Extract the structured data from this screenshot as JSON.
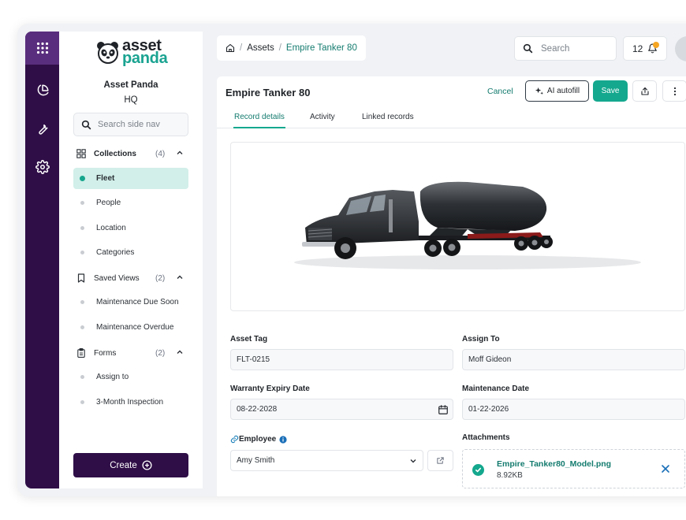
{
  "app": {
    "brand_asset": "asset",
    "brand_panda": "panda",
    "org_name": "Asset Panda",
    "org_sub": "HQ"
  },
  "sidenav": {
    "search_placeholder": "Search side nav",
    "groups": [
      {
        "label": "Collections",
        "count": "(4)",
        "items": [
          "Fleet",
          "People",
          "Location",
          "Categories"
        ],
        "active": "Fleet"
      },
      {
        "label": "Saved Views",
        "count": "(2)",
        "items": [
          "Maintenance Due Soon",
          "Maintenance Overdue"
        ]
      },
      {
        "label": "Forms",
        "count": "(2)",
        "items": [
          "Assign to",
          "3-Month Inspection"
        ]
      }
    ],
    "create_label": "Create"
  },
  "header": {
    "breadcrumb": [
      "Assets",
      "Empire Tanker 80"
    ],
    "search_placeholder": "Search",
    "notification_count": "12"
  },
  "record": {
    "title": "Empire Tanker 80",
    "cancel_label": "Cancel",
    "ai_label": "AI autofill",
    "save_label": "Save",
    "tabs": [
      "Record details",
      "Activity",
      "Linked records"
    ],
    "fields": {
      "asset_tag_label": "Asset Tag",
      "asset_tag_value": "FLT-0215",
      "assign_to_label": "Assign To",
      "assign_to_value": "Moff Gideon",
      "warranty_label": "Warranty Expiry Date",
      "warranty_value": "08-22-2028",
      "maintenance_label": "Maintenance Date",
      "maintenance_value": "01-22-2026",
      "employee_label": "Employee",
      "employee_value": "Amy Smith",
      "attachments_label": "Attachments"
    },
    "attachment": {
      "name": "Empire_Tanker80_Model.png",
      "size": "8.92KB"
    }
  },
  "colors": {
    "rail": "#2f0e47",
    "rail_top": "#5a2e7e",
    "accent": "#14a88e",
    "accent_text": "#137b6e",
    "active_bg": "#d2efe9"
  }
}
